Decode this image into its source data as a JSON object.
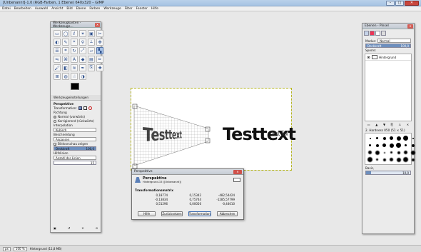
{
  "window": {
    "title": "[Unbenannt]-1.0 (RGB-Farben, 1 Ebene) 640x320 – GIMP",
    "min_label": "–",
    "max_label": "□",
    "close_label": "✕"
  },
  "menu": [
    "Datei",
    "Bearbeiten",
    "Auswahl",
    "Ansicht",
    "Bild",
    "Ebene",
    "Farben",
    "Werkzeuge",
    "Filter",
    "Fenster",
    "Hilfe"
  ],
  "toolbox": {
    "title": "Werkzeugkasten - Werkzeuge...",
    "tool_icons": [
      "rect-select-icon",
      "ellipse-select-icon",
      "free-select-icon",
      "fuzzy-select-icon",
      "color-select-icon",
      "scissors-icon",
      "foreground-select-icon",
      "paths-icon",
      "color-picker-icon",
      "zoom-icon",
      "measure-icon",
      "move-icon",
      "align-icon",
      "crop-icon",
      "rotate-icon",
      "scale-icon",
      "shear-icon",
      "perspective-icon",
      "flip-icon",
      "cage-icon",
      "text-icon",
      "bucket-fill-icon",
      "blend-icon",
      "pencil-icon",
      "paintbrush-icon",
      "eraser-icon",
      "airbrush-icon",
      "ink-icon",
      "clone-icon",
      "heal-icon",
      "perspective-clone-icon",
      "blur-icon",
      "smudge-icon",
      "dodge-icon"
    ],
    "tool_glyphs": [
      "▭",
      "◯",
      "ℓ",
      "✶",
      "▣",
      "✂",
      "◐",
      "✎",
      "⌖",
      "⚲",
      "⟂",
      "✥",
      "☰",
      "⌗",
      "↻",
      "⤢",
      "▱",
      "▚",
      "⇋",
      "⌘",
      "A",
      "◆",
      "▤",
      "✏",
      "🖌",
      "◧",
      "≋",
      "✒",
      "⎘",
      "✚",
      "⊞",
      "◍",
      "☝",
      "◑"
    ],
    "active_tool_index": 17,
    "options_tab": "Werkzeugeinstellungen",
    "tool_name": "Perspektive",
    "transform_label": "Transformation:",
    "direction_label": "Richtung",
    "direction_options": [
      "Normal (vorwärts)",
      "Korrigierend (rückwärts)"
    ],
    "interpolation_label": "Interpolation",
    "interpolation_value": "Kubisch",
    "clipping_label": "Beschneidung",
    "clipping_value": "Anpassen",
    "preview_label": "Bildvorschau zeigen",
    "opacity_label": "Deckkraft",
    "opacity_value": "100,0",
    "opacity_fraction": 1.0,
    "guides_label": "Hilfslinien",
    "guides_value": "Anzahl der Linien",
    "guides_count": "15"
  },
  "canvas": {
    "text_main": "Testtext",
    "text_small": "Text Tex"
  },
  "dialog": {
    "title": "Perspektive",
    "heading": "Perspektive",
    "subheading": "Hintergrund-15 ([Unbenannt])",
    "matrix_label": "Transformationsmatrix",
    "matrix": [
      [
        "0,18774",
        "0,15342",
        "-482,54424"
      ],
      [
        "-0,13834",
        "0,75744",
        "-1285,57799"
      ],
      [
        "0,51296",
        "0,00056",
        "-0,44010"
      ]
    ],
    "buttons": {
      "help": "Hilfe",
      "reset": "Zurücksetzen",
      "transform": "Transformation",
      "cancel": "Abbrechen"
    }
  },
  "layers": {
    "title": "Ebenen - Pinsel",
    "mode_label": "Modus:",
    "mode_value": "Normal",
    "opacity_label": "Deckkraft",
    "opacity_value": "100,0",
    "lock_label": "Sperre:",
    "layer_name": "Hintergrund",
    "brush_title": "2. Hardness 050 (51 × 51)",
    "spacing_label": "Basic,",
    "spacing_value": "10,0"
  },
  "status": {
    "unit": "px",
    "zoom": "100 %",
    "info": "Hintergrund (11,8 MB)"
  }
}
